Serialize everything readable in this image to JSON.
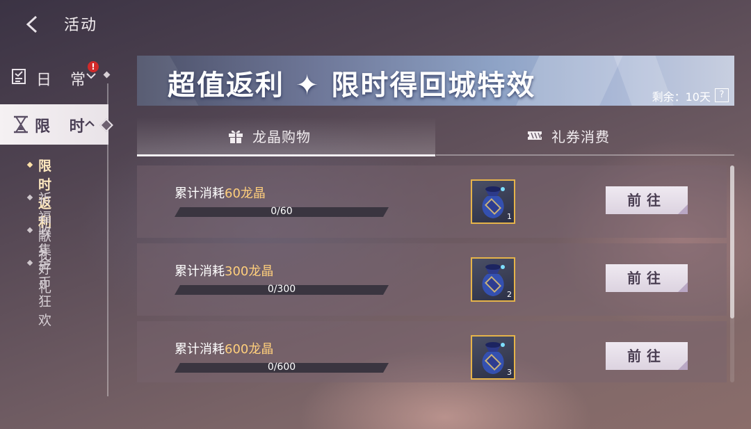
{
  "header": {
    "title": "活动",
    "back_icon": "chevron-left-icon"
  },
  "sidebar": {
    "daily": {
      "label": "日 常",
      "badge": "!",
      "icon": "checklist-icon"
    },
    "limited": {
      "label": "限 时",
      "icon": "hourglass-icon"
    },
    "sub_items": [
      {
        "label": "限时返利",
        "active": true
      },
      {
        "label": "祈福献礼",
        "active": false
      },
      {
        "label": "收集好礼",
        "active": false
      },
      {
        "label": "金币狂欢",
        "active": false
      }
    ]
  },
  "banner": {
    "title": "超值返利 ✦ 限时得回城特效",
    "remaining": "剩余：10天",
    "help": "?"
  },
  "tabs": [
    {
      "label": "龙晶购物",
      "icon": "gift-icon",
      "active": true
    },
    {
      "label": "礼券消费",
      "icon": "ticket-icon",
      "active": false
    }
  ],
  "rewards": [
    {
      "prefix": "累计消耗",
      "amount": "60龙晶",
      "progress": "0/60",
      "progress_fraction": 0,
      "reward_count": "1",
      "reward_icon": "lucky-bag-icon",
      "button": "前往"
    },
    {
      "prefix": "累计消耗",
      "amount": "300龙晶",
      "progress": "0/300",
      "progress_fraction": 0,
      "reward_count": "2",
      "reward_icon": "lucky-bag-icon",
      "button": "前往"
    },
    {
      "prefix": "累计消耗",
      "amount": "600龙晶",
      "progress": "0/600",
      "progress_fraction": 0,
      "reward_count": "3",
      "reward_icon": "lucky-bag-icon",
      "button": "前往"
    }
  ],
  "colors": {
    "highlight": "#ffcf7c",
    "reward_border": "#e6b44a",
    "badge": "#d22a2a"
  }
}
